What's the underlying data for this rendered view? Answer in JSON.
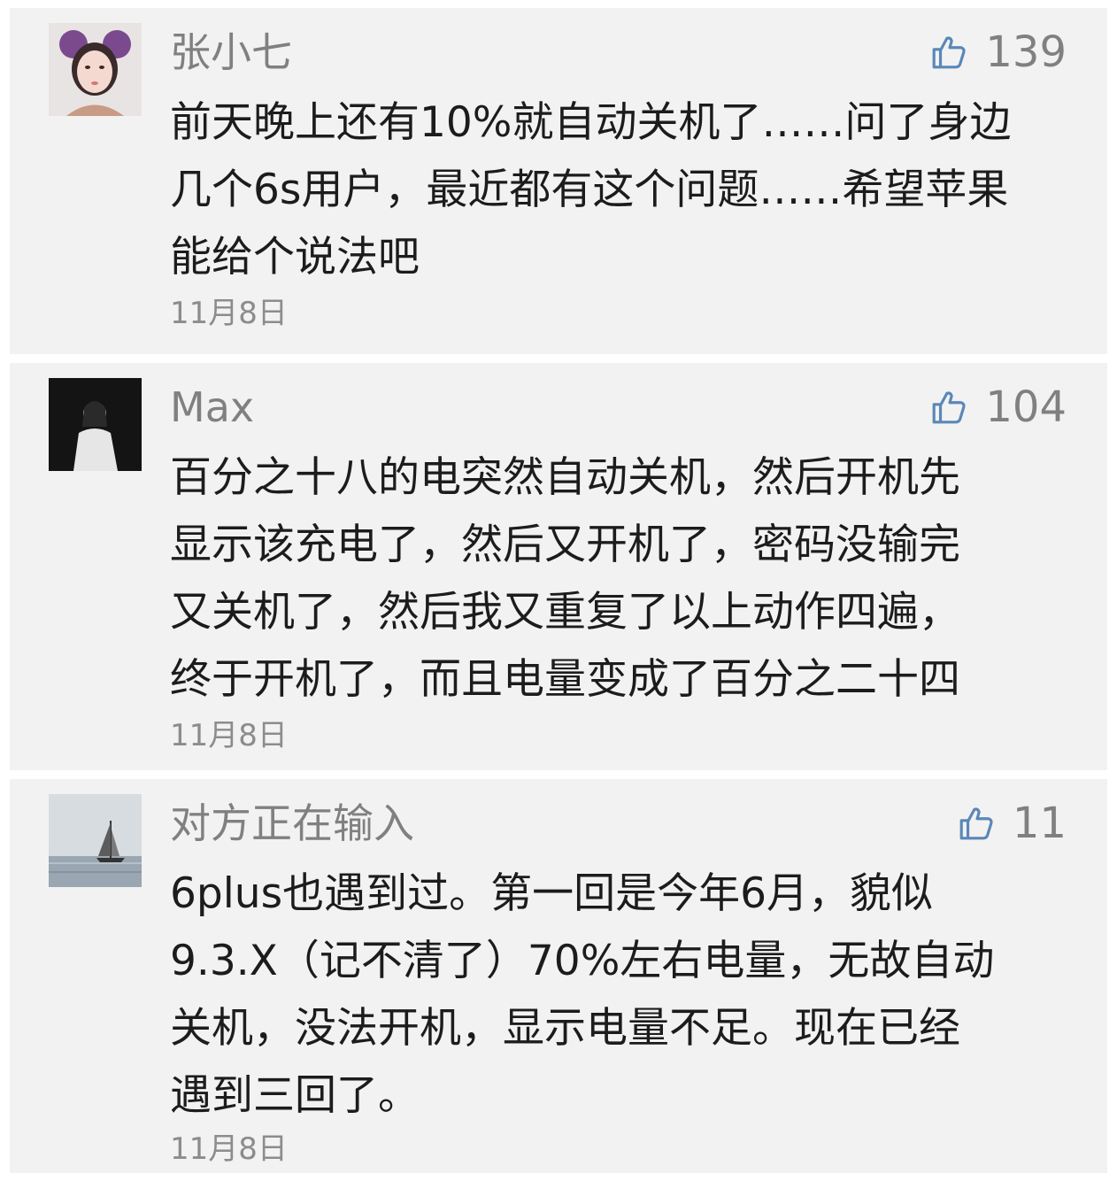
{
  "comments": [
    {
      "username": "张小七",
      "likes": "139",
      "content": "前天晚上还有10%就自动关机了……问了身边\n几个6s用户，最近都有这个问题……希望苹果\n能给个说法吧",
      "date": "11月8日"
    },
    {
      "username": "Max",
      "likes": "104",
      "content": "百分之十八的电突然自动关机，然后开机先\n显示该充电了，然后又开机了，密码没输完\n又关机了，然后我又重复了以上动作四遍，\n终于开机了，而且电量变成了百分之二十四",
      "date": "11月8日"
    },
    {
      "username": "对方正在输入",
      "likes": "11",
      "content": "6plus也遇到过。第一回是今年6月，貌似\n9.3.X（记不清了）70%左右电量，无故自动\n关机，没法开机，显示电量不足。现在已经\n遇到三回了。",
      "date": "11月8日"
    }
  ],
  "icons": {
    "like": "thumbs-up-outline-icon",
    "avatar": "user-avatar-photo"
  },
  "colors": {
    "card_background": "#f2f2f2",
    "username": "#808080",
    "content_text": "#1c1c1c",
    "like_icon": "#5a87b8",
    "date": "#8c8c8c"
  }
}
